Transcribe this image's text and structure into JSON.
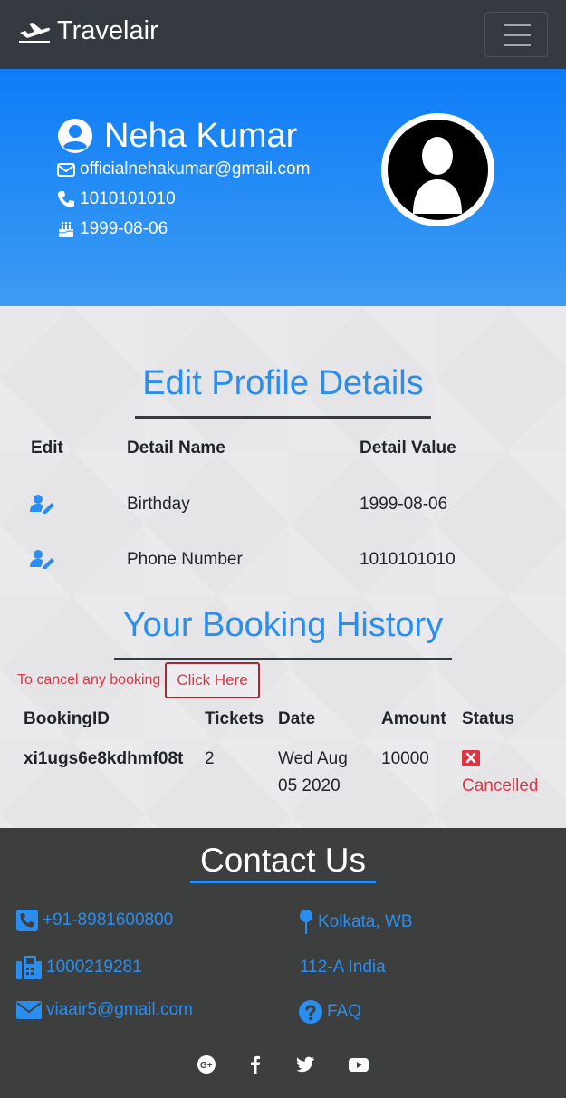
{
  "navbar": {
    "brand": "Travelair",
    "icons": {
      "brand": "airplane-icon",
      "menu": "hamburger-menu-icon"
    }
  },
  "profile": {
    "name": "Neha Kumar",
    "email": "officialnehakumar@gmail.com",
    "phone": "1010101010",
    "birthday": "1999-08-06",
    "icons": {
      "name": "user-circle-icon",
      "email": "envelope-icon",
      "phone": "phone-icon",
      "birthday": "birthday-cake-icon",
      "avatar": "user-avatar"
    }
  },
  "edit_section": {
    "title": "Edit Profile Details",
    "columns": [
      "Edit",
      "Detail Name",
      "Detail Value"
    ],
    "rows": [
      {
        "name": "Birthday",
        "value": "1999-08-06"
      },
      {
        "name": "Phone Number",
        "value": "1010101010"
      }
    ],
    "edit_icon": "user-edit-icon"
  },
  "booking_section": {
    "title": "Your Booking History",
    "cancel_note": "To cancel any booking",
    "cancel_button": "Click Here",
    "columns": [
      "BookingID",
      "Tickets",
      "Date",
      "Amount",
      "Status"
    ],
    "rows": [
      {
        "booking_id": "xi1ugs6e8kdhmf08t",
        "tickets": "2",
        "date_line1": "Wed Aug",
        "date_line2": "05 2020",
        "amount": "10000",
        "status": "Cancelled"
      }
    ],
    "status_icon": "x-square-icon"
  },
  "footer": {
    "title": "Contact Us",
    "phone": "+91-8981600800",
    "fax": "1000219281",
    "email": "viaair5@gmail.com",
    "location": "Kolkata, WB",
    "address": "112-A India",
    "faq": "FAQ",
    "social": [
      "google-plus-icon",
      "facebook-icon",
      "twitter-icon",
      "youtube-icon"
    ]
  },
  "colors": {
    "navbar": "#343a40",
    "hero_top": "#0d7cf9",
    "hero_bottom": "#3d9cf2",
    "accent": "#2a8ef1",
    "danger": "#dc3545",
    "footer": "#3d3f3e"
  }
}
